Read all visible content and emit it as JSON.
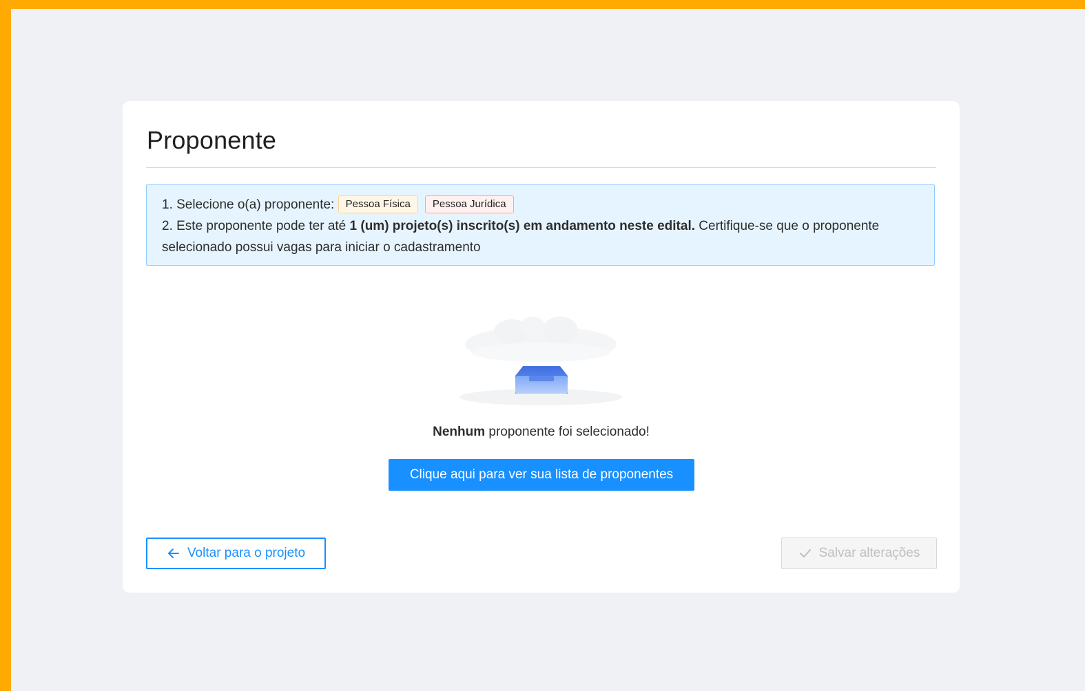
{
  "page": {
    "title": "Proponente"
  },
  "info": {
    "line1_prefix": "1. Selecione o(a) proponente:",
    "tag_pf": "Pessoa Física",
    "tag_pj": "Pessoa Jurídica",
    "line2_prefix": "2. Este proponente pode ter até ",
    "line2_bold": "1 (um) projeto(s) inscrito(s) em andamento neste edital.",
    "line2_suffix": " Certifique-se que o proponente selecionado possui vagas para iniciar o cadastramento"
  },
  "empty": {
    "bold": "Nenhum",
    "text": " proponente foi selecionado!",
    "icon": "empty-inbox-icon"
  },
  "actions": {
    "list_button": "Clique aqui para ver sua lista de proponentes",
    "back_button": "Voltar para o projeto",
    "save_button": "Salvar alterações"
  },
  "colors": {
    "frame": "#FFAA00",
    "background": "#F0F1F5",
    "primary": "#1890FF",
    "info_bg": "#E6F4FF",
    "info_border": "#91CAFF"
  }
}
